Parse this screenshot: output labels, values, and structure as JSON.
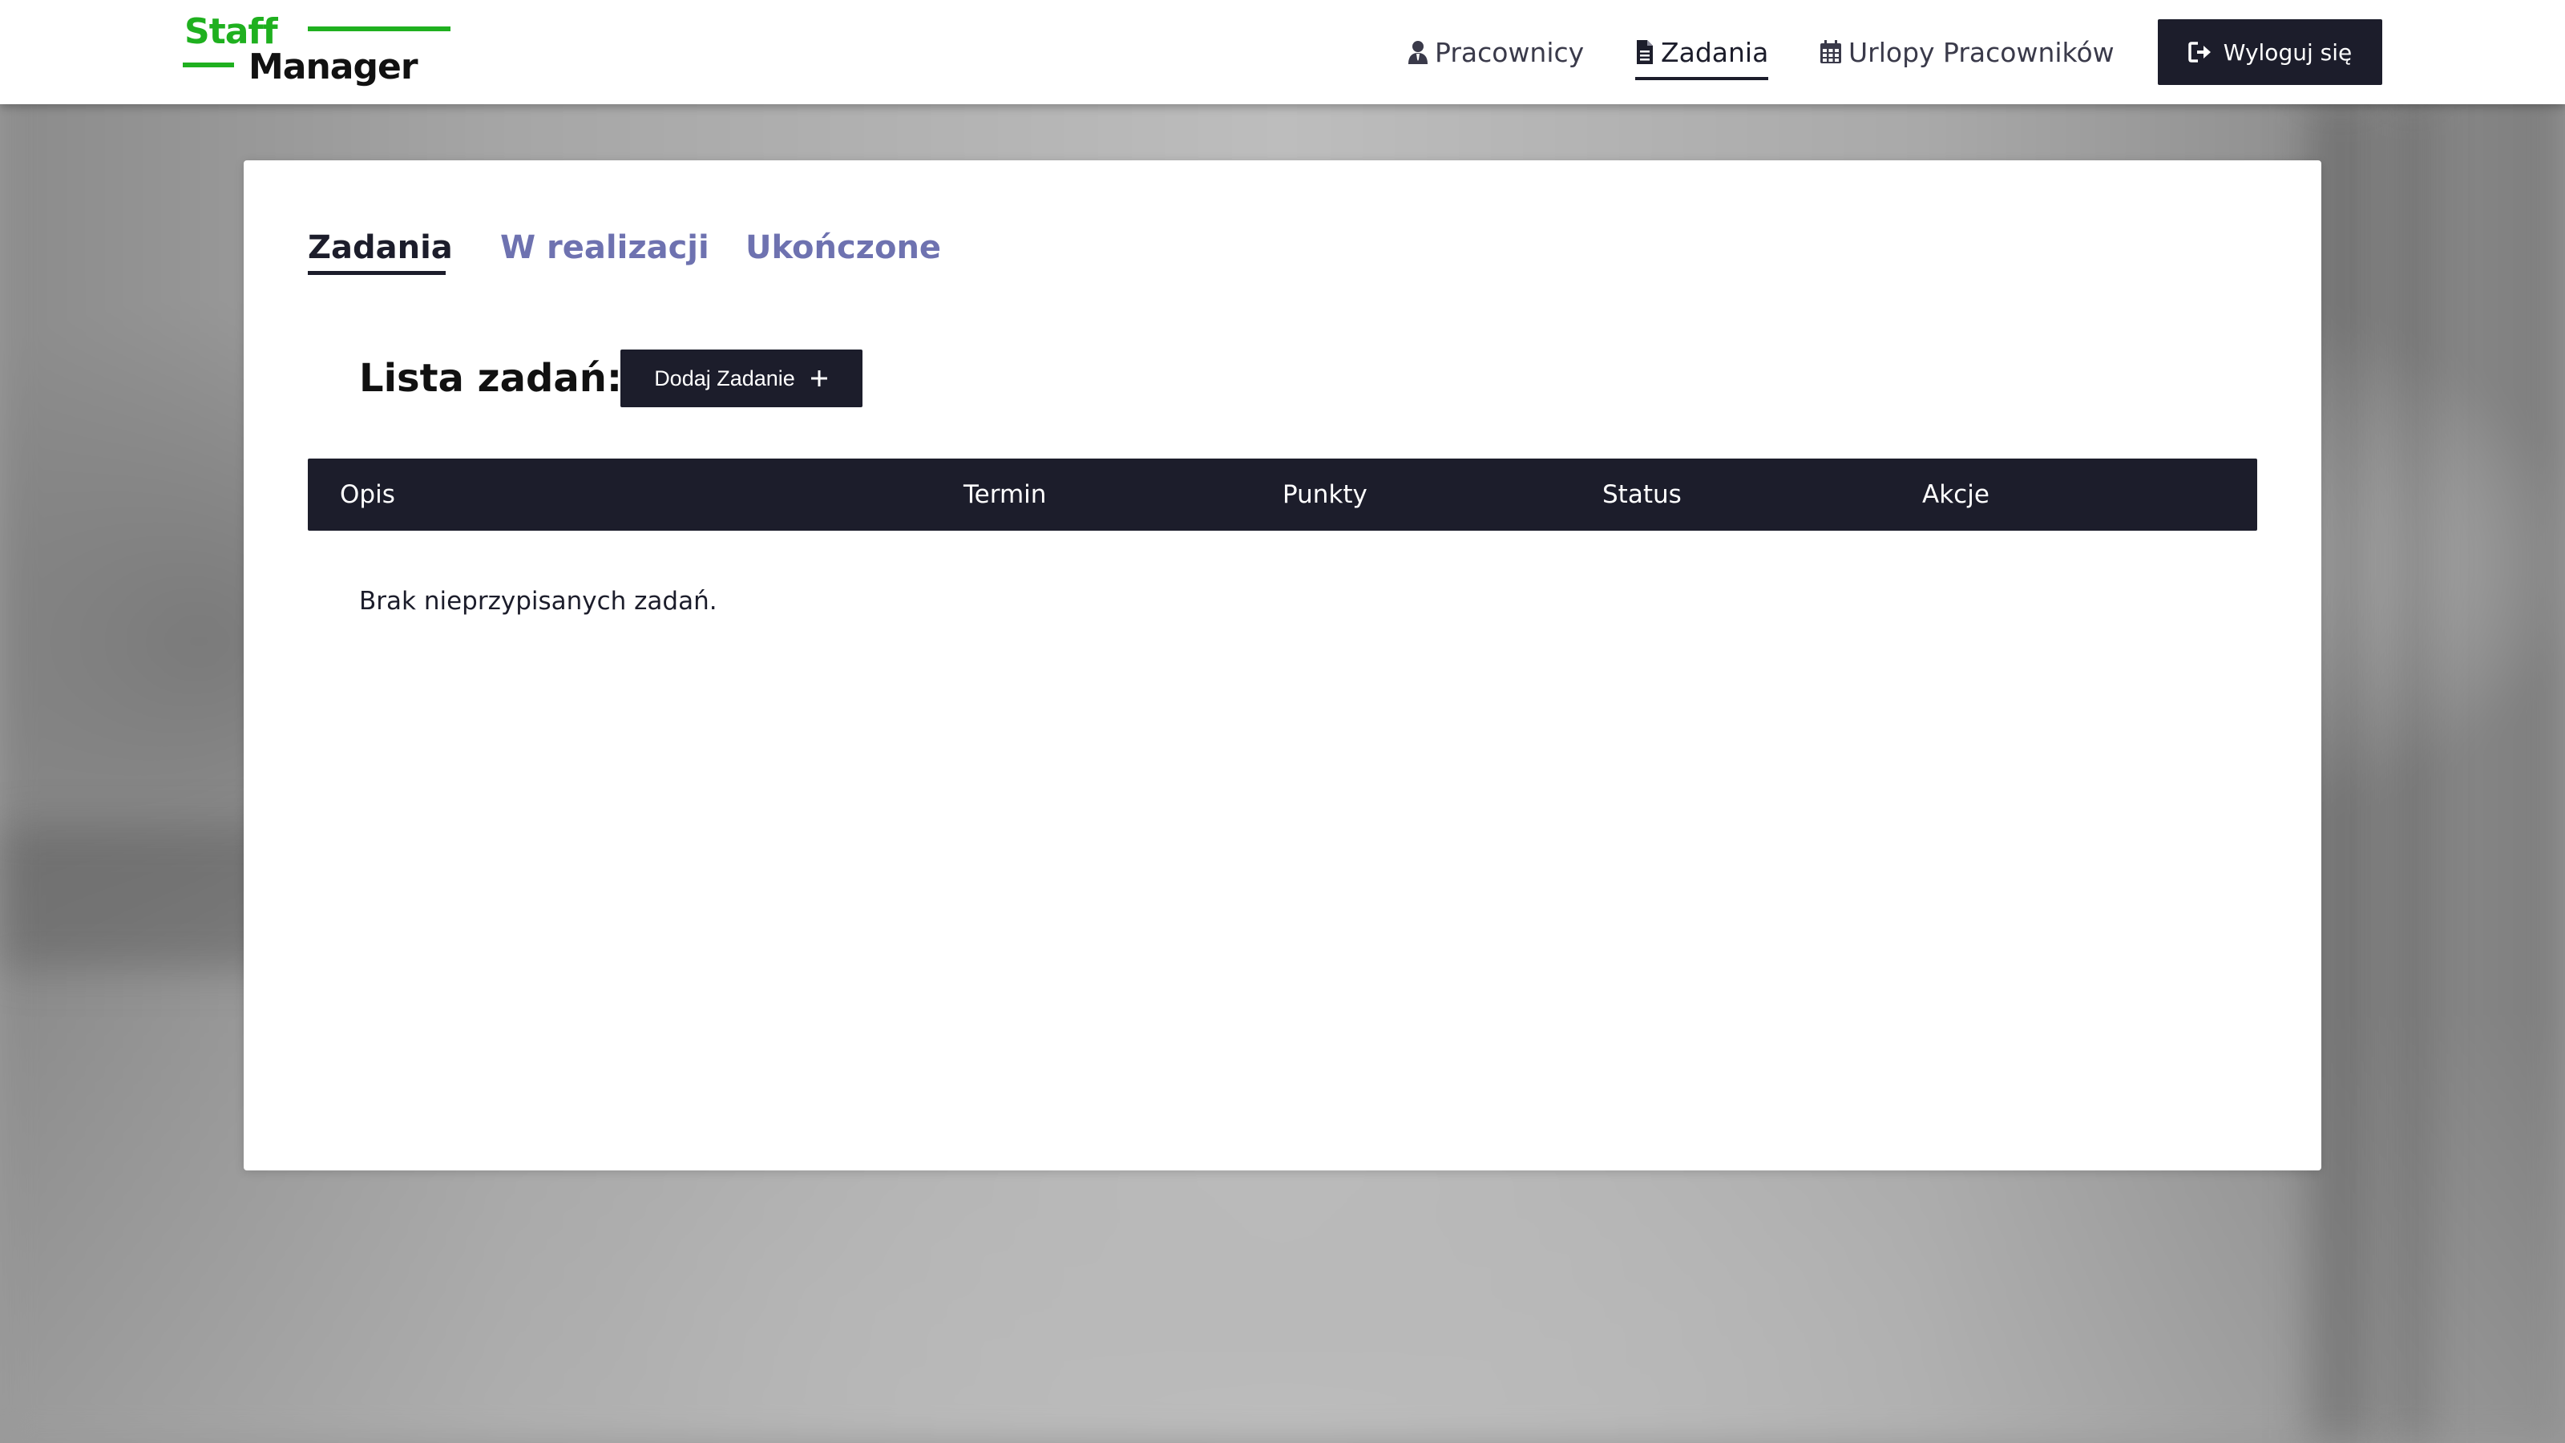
{
  "brand": {
    "line1": "Staff",
    "line2": "Manager",
    "accent_color": "#1fb01f"
  },
  "nav": {
    "items": [
      {
        "label": "Pracownicy",
        "icon": "user-tie-icon",
        "active": false
      },
      {
        "label": "Zadania",
        "icon": "file-icon",
        "active": true
      },
      {
        "label": "Urlopy Pracowników",
        "icon": "calendar-icon",
        "active": false
      }
    ],
    "logout_label": "Wyloguj się",
    "logout_icon": "sign-out-icon"
  },
  "tabs": [
    {
      "label": "Zadania",
      "active": true
    },
    {
      "label": "W realizacji",
      "active": false
    },
    {
      "label": "Ukończone",
      "active": false
    }
  ],
  "tasks": {
    "title": "Lista zadań:",
    "add_button_label": "Dodaj Zadanie",
    "add_button_icon": "plus-icon",
    "columns": [
      "Opis",
      "Termin",
      "Punkty",
      "Status",
      "Akcje"
    ],
    "rows": [],
    "empty_message": "Brak nieprzypisanych zadań."
  },
  "colors": {
    "primary_dark": "#1c1d2b",
    "tab_inactive": "#6e72b0"
  }
}
